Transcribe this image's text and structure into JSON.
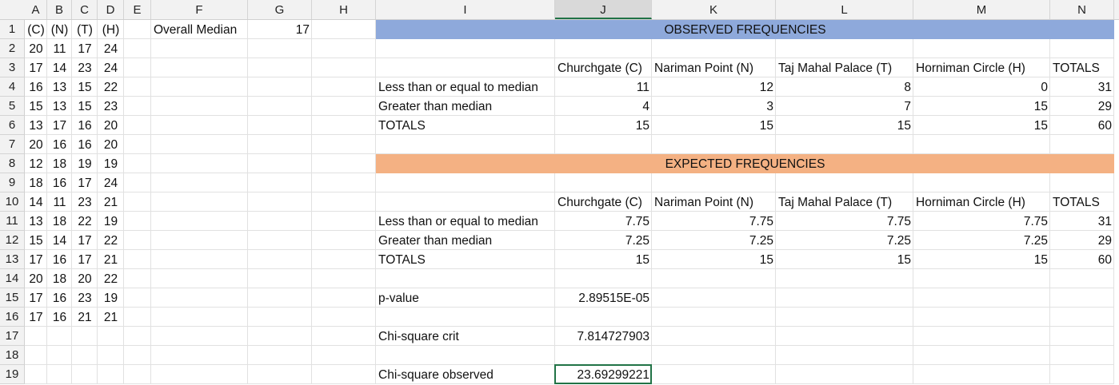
{
  "columns": [
    "A",
    "B",
    "C",
    "D",
    "E",
    "F",
    "G",
    "H",
    "I",
    "J",
    "K",
    "L",
    "M",
    "N"
  ],
  "selected_column": "J",
  "rows": [
    "1",
    "2",
    "3",
    "4",
    "5",
    "6",
    "7",
    "8",
    "9",
    "10",
    "11",
    "12",
    "13",
    "14",
    "15",
    "16",
    "17",
    "18",
    "19"
  ],
  "raw_headers": [
    "(C)",
    "(N)",
    "(T)",
    "(H)"
  ],
  "raw_data": [
    [
      "20",
      "11",
      "17",
      "24"
    ],
    [
      "17",
      "14",
      "23",
      "24"
    ],
    [
      "16",
      "13",
      "15",
      "22"
    ],
    [
      "15",
      "13",
      "15",
      "23"
    ],
    [
      "13",
      "17",
      "16",
      "20"
    ],
    [
      "20",
      "16",
      "16",
      "20"
    ],
    [
      "12",
      "18",
      "19",
      "19"
    ],
    [
      "18",
      "16",
      "17",
      "24"
    ],
    [
      "14",
      "11",
      "23",
      "21"
    ],
    [
      "13",
      "18",
      "22",
      "19"
    ],
    [
      "15",
      "14",
      "17",
      "22"
    ],
    [
      "17",
      "16",
      "17",
      "21"
    ],
    [
      "20",
      "18",
      "20",
      "22"
    ],
    [
      "17",
      "16",
      "23",
      "19"
    ],
    [
      "17",
      "16",
      "21",
      "21"
    ]
  ],
  "overall_median_label": "Overall Median",
  "overall_median_value": "17",
  "observed": {
    "title": "OBSERVED FREQUENCIES",
    "headers": [
      "Churchgate (C)",
      "Nariman Point (N)",
      "Taj Mahal Palace (T)",
      "Horniman Circle (H)",
      "TOTALS"
    ],
    "rows": [
      {
        "label": "Less than or equal to median",
        "values": [
          "11",
          "12",
          "8",
          "0",
          "31"
        ]
      },
      {
        "label": "Greater than median",
        "values": [
          "4",
          "3",
          "7",
          "15",
          "29"
        ]
      },
      {
        "label": "TOTALS",
        "values": [
          "15",
          "15",
          "15",
          "15",
          "60"
        ]
      }
    ]
  },
  "expected": {
    "title": "EXPECTED FREQUENCIES",
    "headers": [
      "Churchgate (C)",
      "Nariman Point (N)",
      "Taj Mahal Palace (T)",
      "Horniman Circle (H)",
      "TOTALS"
    ],
    "rows": [
      {
        "label": "Less than or equal to median",
        "values": [
          "7.75",
          "7.75",
          "7.75",
          "7.75",
          "31"
        ]
      },
      {
        "label": "Greater than median",
        "values": [
          "7.25",
          "7.25",
          "7.25",
          "7.25",
          "29"
        ]
      },
      {
        "label": "TOTALS",
        "values": [
          "15",
          "15",
          "15",
          "15",
          "60"
        ]
      }
    ]
  },
  "stats": [
    {
      "label": "p-value",
      "value": "2.89515E-05"
    },
    {
      "label": "Chi-square crit",
      "value": "7.814727903"
    },
    {
      "label": "Chi-square observed",
      "value": "23.69299221"
    }
  ],
  "colors": {
    "observed_band": "#8ea9db",
    "expected_band": "#f4b183",
    "selection": "#217346"
  }
}
